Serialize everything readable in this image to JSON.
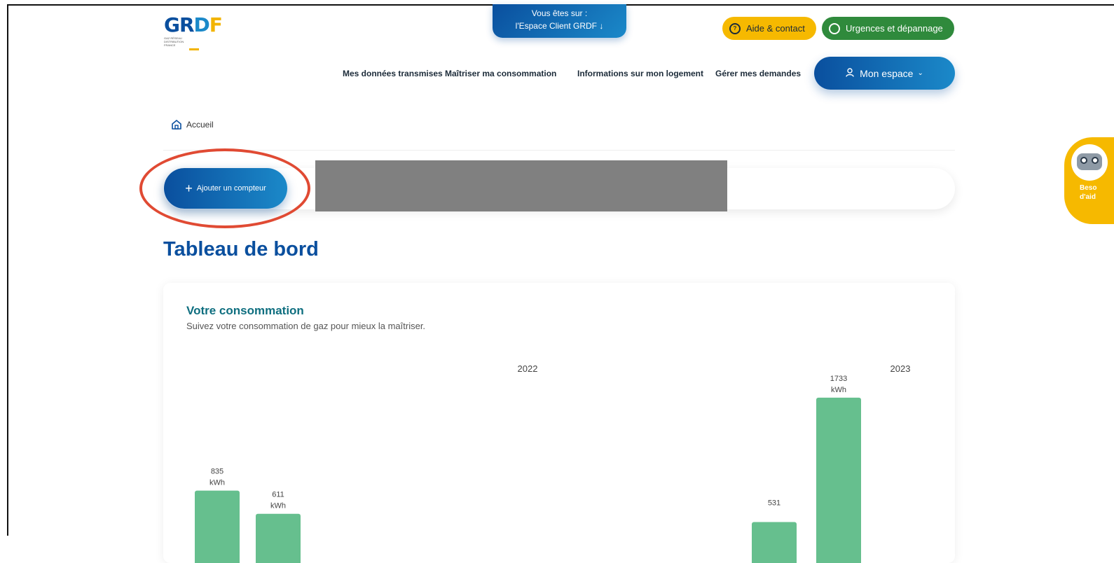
{
  "header": {
    "logo": {
      "text": "GRDF",
      "tagline": "GAZ RÉSEAU DISTRIBUTION FRANCE"
    },
    "space_tab": {
      "line1": "Vous êtes sur :",
      "line2": "l'Espace Client GRDF"
    },
    "help_label": "Aide & contact",
    "urgent_label": "Urgences et dépannage",
    "nav": [
      "Mes données transmises",
      "Maîtriser ma consommation",
      "Informations sur mon logement",
      "Gérer mes demandes"
    ],
    "espace_label": "Mon espace",
    "colors": {
      "primary": "#0a4f9e",
      "accent": "#1b89c9",
      "yellow": "#f6b900",
      "green": "#2f8a3c"
    }
  },
  "breadcrumb": {
    "home": "Accueil"
  },
  "meter": {
    "add_label": "Ajouter un compteur"
  },
  "page_title": "Tableau de bord",
  "consumption": {
    "title": "Votre consommation",
    "subtitle": "Suivez votre consommation de gaz pour mieux la maîtriser."
  },
  "chart_data": {
    "type": "bar",
    "year_labels": [
      "2022",
      "2023"
    ],
    "unit": "kWh",
    "bars": [
      {
        "value": 835,
        "label": "835",
        "unit": "kWh"
      },
      {
        "value": 611,
        "label": "611",
        "unit": "kWh"
      },
      {
        "value": 531,
        "label": "531",
        "unit": ""
      },
      {
        "value": 1733,
        "label": "1733",
        "unit": "kWh"
      }
    ],
    "bar_color": "#66bf8e"
  },
  "helper": {
    "line1": "Beso",
    "line2": "d'aid"
  }
}
